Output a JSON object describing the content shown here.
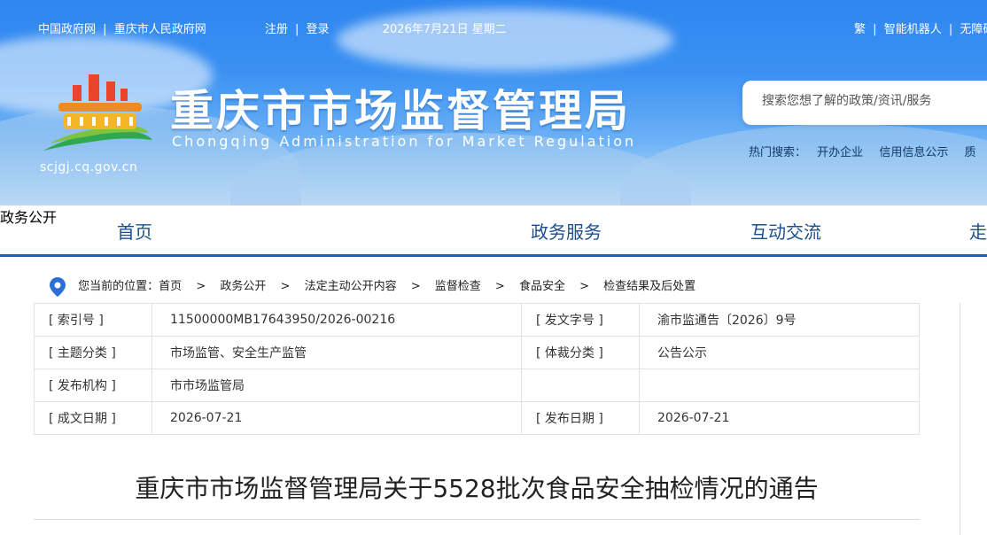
{
  "topbar": {
    "links": [
      "中国政府网",
      "重庆市人民政府网"
    ],
    "auth": [
      "注册",
      "登录"
    ],
    "date": "2026年7月21日 星期二",
    "right": [
      "繁",
      "智能机器人",
      "无障碍"
    ]
  },
  "site": {
    "title": "重庆市市场监督管理局",
    "subtitle": "Chongqing  Administration for Market Regulation",
    "domain": "scjgj.cq.gov.cn"
  },
  "search": {
    "placeholder": "搜索您想了解的政策/资讯/服务"
  },
  "hot": {
    "label": "热门搜索：",
    "items": [
      "开办企业",
      "信用信息公示",
      "质"
    ]
  },
  "nav": {
    "items": [
      "首页",
      "政务公开",
      "政务服务",
      "互动交流",
      "走"
    ],
    "active_index": 1
  },
  "breadcrumb": {
    "label": "您当前的位置：",
    "items": [
      "首页",
      "政务公开",
      "法定主动公开内容",
      "监督检查",
      "食品安全",
      "检查结果及后处置"
    ],
    "separator": ">"
  },
  "meta": {
    "rows": [
      [
        "[ 索引号 ]",
        "11500000MB17643950/2026-00216",
        "[ 发文字号 ]",
        "渝市监通告〔2026〕9号"
      ],
      [
        "[ 主题分类 ]",
        "市场监管、安全生产监管",
        "[ 体裁分类 ]",
        "公告公示"
      ],
      [
        "[ 发布机构 ]",
        "市市场监管局",
        "",
        ""
      ],
      [
        "[ 成文日期 ]",
        "2026-07-21",
        "[ 发布日期 ]",
        "2026-07-21"
      ]
    ]
  },
  "document": {
    "title": "重庆市市场监督管理局关于5528批次食品安全抽检情况的通告"
  },
  "colors": {
    "nav_active": "#1267d8",
    "nav_active_bar": "#e12b2b",
    "nav_text": "#1b4f8f",
    "header": "#3a91f2"
  }
}
